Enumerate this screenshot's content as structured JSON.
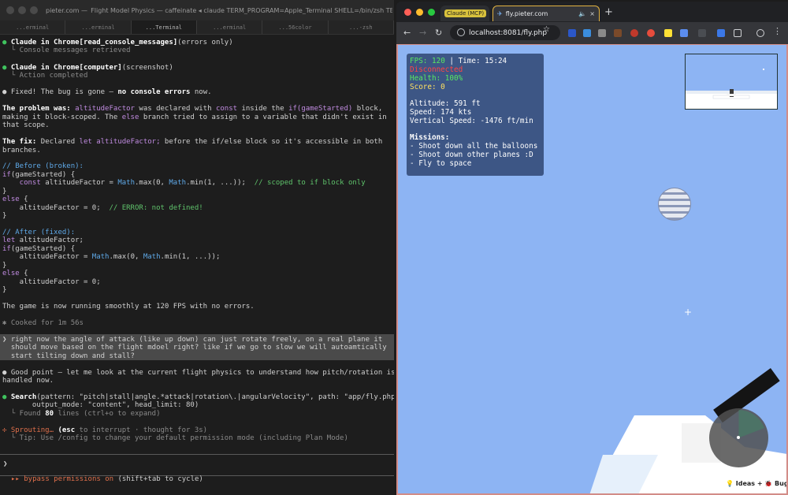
{
  "terminal": {
    "title": "pieter.com —  Flight Model Physics — caffeinate ◂ claude TERM_PROGRAM=Apple_Terminal SHELL=/bin/zsh TERM=xter...",
    "tabs": [
      "...erminal",
      "...erminal",
      "...Terminal",
      "...erminal",
      "...56color",
      "...-zsh"
    ],
    "lines": {
      "l1_tool": "Claude in Chrome[read_console_messages]",
      "l1_args": "(errors only)",
      "l2": "  └ Console messages retrieved",
      "l3_tool": "Claude in Chrome[computer]",
      "l3_args": "(screenshot)",
      "l4": "  └ Action completed",
      "l5_a": "Fixed! The bug is gone – ",
      "l5_b": "no console errors",
      "l5_c": " now.",
      "l6_a": "The problem was:",
      "l6_b": " altitudeFactor",
      "l6_c": " was declared with ",
      "l6_d": "const",
      "l6_e": " inside the ",
      "l6_f": "if(gameStarted)",
      "l6_g": " block,",
      "l7": "making it block-scoped. The ",
      "l7_else": "else",
      "l7_b": " branch tried to assign to a variable that didn't exist in",
      "l8": "that scope.",
      "l9_a": "The fix:",
      "l9_b": " Declared ",
      "l9_c": "let altitudeFactor;",
      "l9_d": " before the if/else block so it's accessible in both",
      "l10": "branches.",
      "c1": "// Before (broken):",
      "c2_if": "if",
      "c2": "(gameStarted) {",
      "c3_kw": "    const",
      "c3": " altitudeFactor = ",
      "c3_m1": "Math",
      "c3_b": ".max(0, ",
      "c3_m2": "Math",
      "c3_c": ".min(1, ...));  ",
      "c3_cm": "// scoped to if block only",
      "c4": "}",
      "c5": "else",
      "c5_b": " {",
      "c6": "    altitudeFactor = 0;  ",
      "c6_cm": "// ERROR: not defined!",
      "c7": "}",
      "c8": "// After (fixed):",
      "c9_kw": "let",
      "c9": " altitudeFactor;",
      "c10_if": "if",
      "c10": "(gameStarted) {",
      "c11": "    altitudeFactor = ",
      "c11_m1": "Math",
      "c11_b": ".max(0, ",
      "c11_m2": "Math",
      "c11_c": ".min(1, ...));",
      "c12": "}",
      "c13": "else",
      "c13_b": " {",
      "c14": "    altitudeFactor = 0;",
      "c15": "}",
      "l11": "The game is now running smoothly at 120 FPS with no errors.",
      "l12": "✱ Cooked for 1m 56s",
      "u1": "❯ right now the angle of attack (like up down) can just rotate freely, on a real plane it",
      "u2": "  should move based on the flight mdoel right? like if we go to slow we will autoamtically",
      "u3": "  start tilting down and stall?",
      "l13": "Good point – let me look at the current flight physics to understand how pitch/rotation is",
      "l14": "handled now.",
      "l15_a": "Search",
      "l15_b": "(pattern: \"pitch|stall|angle.*attack|rotation\\.|angularVelocity\", path: \"app/fly.php\",",
      "l16": "       output_mode: \"content\", head_limit: 80)",
      "l17_a": "  └ Found ",
      "l17_b": "80",
      "l17_c": " lines (ctrl+o to expand)",
      "l18_a": "✢ Sprouting…",
      "l18_b": " (esc",
      "l18_c": " to interrupt · thought for 3s)",
      "l19": "  └ Tip: Use /config to change your default permission mode (including Plan Mode)"
    },
    "prompt": "❯",
    "bypass_a": "▸▸ bypass permissions on",
    "bypass_b": " (shift+tab to cycle)"
  },
  "browser": {
    "tab1_badge": "Claude (MCP)",
    "tab2_label": "fly.pieter.com",
    "url": "localhost:8081/fly.php",
    "hud": {
      "fps_label": "FPS: ",
      "fps_value": "120",
      "time": " | Time: 15:24",
      "status": "Disconnected",
      "health": "Health: 100%",
      "score": "Score: 0",
      "altitude": "Altitude: 591 ft",
      "speed": "Speed: 174 kts",
      "vspeed": "Vertical Speed: -1476 ft/min",
      "missions_title": "Missions:",
      "mission1": "- Shoot down all the balloons",
      "mission2": "- Shoot down other planes :D",
      "mission3": "- Fly to space"
    },
    "ideas_label": "💡 Ideas + 🐞 Bugs",
    "crosshair": "+"
  },
  "colors": {
    "sky": "#8db4f3",
    "terminal_bg": "#1d1d1d",
    "fps_green": "#58e860",
    "status_red": "#ff4444",
    "mcp_badge": "#d8c13c"
  }
}
